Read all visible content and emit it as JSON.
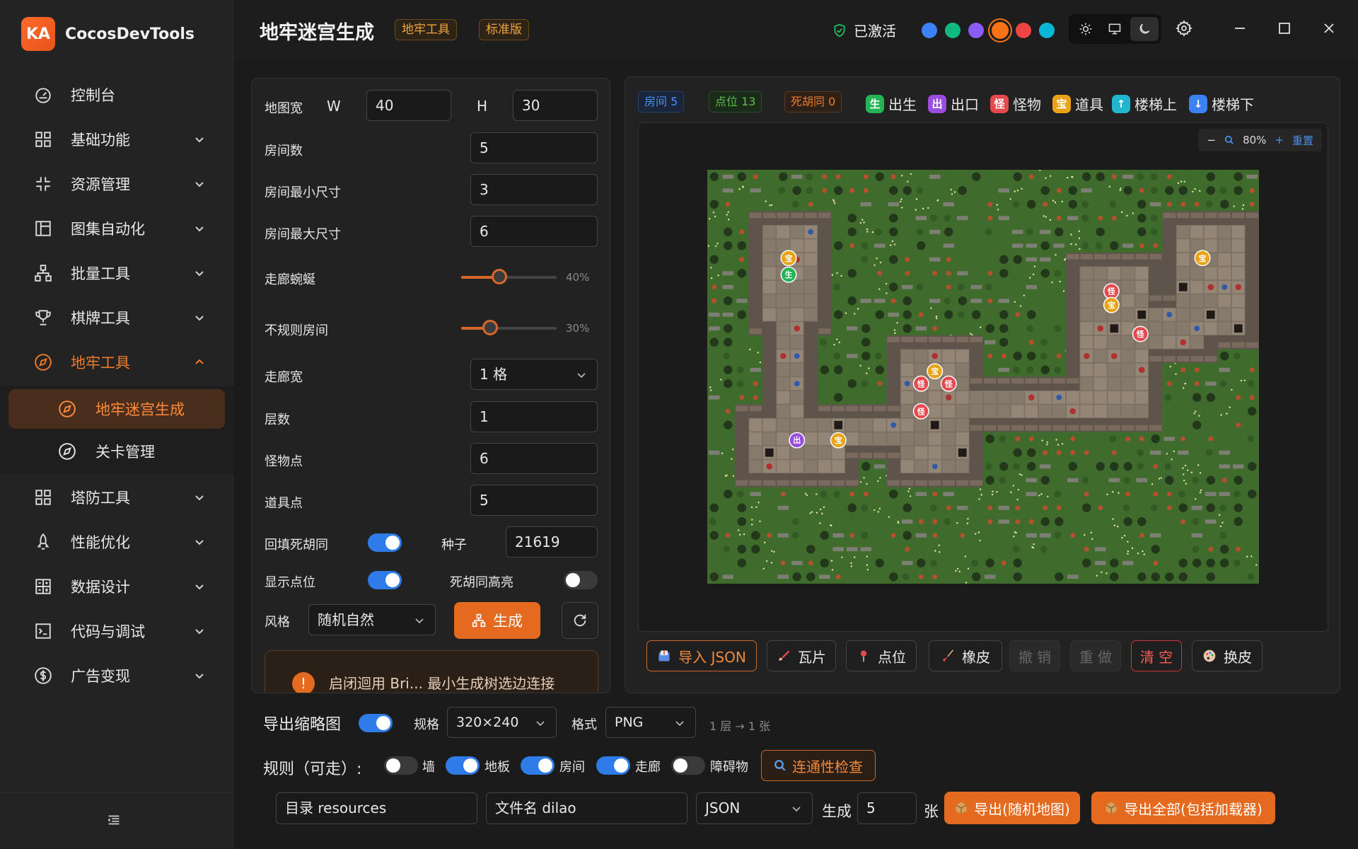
{
  "app": {
    "logo_text": "KA",
    "name": "CocosDevTools"
  },
  "sidebar": {
    "items": [
      {
        "label": "控制台",
        "icon": "dashboard-icon"
      },
      {
        "label": "基础功能",
        "icon": "grid-icon"
      },
      {
        "label": "资源管理",
        "icon": "compress-icon"
      },
      {
        "label": "图集自动化",
        "icon": "layout-icon"
      },
      {
        "label": "批量工具",
        "icon": "hierarchy-icon"
      },
      {
        "label": "棋牌工具",
        "icon": "trophy-icon"
      },
      {
        "label": "地牢工具",
        "icon": "compass-icon"
      },
      {
        "label": "塔防工具",
        "icon": "grid-icon"
      },
      {
        "label": "性能优化",
        "icon": "rocket-icon"
      },
      {
        "label": "数据设计",
        "icon": "calculator-icon"
      },
      {
        "label": "代码与调试",
        "icon": "terminal-icon"
      },
      {
        "label": "广告变现",
        "icon": "dollar-icon"
      }
    ],
    "sub_items": [
      {
        "label": "地牢迷宫生成",
        "icon": "compass-icon"
      },
      {
        "label": "关卡管理",
        "icon": "compass-icon"
      }
    ]
  },
  "header": {
    "title": "地牢迷宫生成",
    "tags": [
      "地牢工具",
      "标准版"
    ],
    "status": "已激活",
    "accent_colors": [
      "#3b82f6",
      "#10b981",
      "#8b5cf6",
      "#f97316",
      "#ef4444",
      "#06b6d4"
    ],
    "selected_accent": "#f97316"
  },
  "form": {
    "map_width_label": "地图宽",
    "w_label": "W",
    "w_value": "40",
    "h_label": "H",
    "h_value": "30",
    "rooms_label": "房间数",
    "rooms_value": "5",
    "room_min_label": "房间最小尺寸",
    "room_min_value": "3",
    "room_max_label": "房间最大尺寸",
    "room_max_value": "6",
    "winding_label": "走廊蜿蜒",
    "winding_pct": "40%",
    "winding_value": 0.4,
    "irregular_label": "不规则房间",
    "irregular_pct": "30%",
    "irregular_value": 0.3,
    "corridor_width_label": "走廊宽",
    "corridor_width_value": "1 格",
    "layers_label": "层数",
    "layers_value": "1",
    "monster_label": "怪物点",
    "monster_value": "6",
    "item_label": "道具点",
    "item_value": "5",
    "fill_deadend_label": "回填死胡同",
    "fill_deadend_on": true,
    "seed_label": "种子",
    "seed_value": "21619",
    "show_points_label": "显示点位",
    "show_points_on": true,
    "deadend_highlight_label": "死胡同高亮",
    "deadend_highlight_on": false,
    "style_label": "风格",
    "style_value": "随机自然",
    "generate_label": "生成",
    "tip_text": "启闭迴用 Bri... 最小生成树选边连接"
  },
  "map": {
    "chips": [
      {
        "label": "房间 5",
        "color": "#4b8ef0"
      },
      {
        "label": "点位 13",
        "color": "#5fbf4a"
      },
      {
        "label": "死胡同 0",
        "color": "#f07a2a"
      }
    ],
    "legend": [
      {
        "glyph": "生",
        "label": "出生",
        "color": "#22b455"
      },
      {
        "glyph": "出",
        "label": "出口",
        "color": "#9b4de0"
      },
      {
        "glyph": "怪",
        "label": "怪物",
        "color": "#e5484d"
      },
      {
        "glyph": "宝",
        "label": "道具",
        "color": "#e8a317"
      },
      {
        "glyph": "↑",
        "label": "楼梯上",
        "color": "#22b5d0"
      },
      {
        "glyph": "↓",
        "label": "楼梯下",
        "color": "#3b82f6"
      }
    ],
    "zoom": "80%",
    "reset_label": "重置",
    "markers": [
      {
        "glyph": "宝",
        "type": "item",
        "col": 5.9,
        "row": 6.4
      },
      {
        "glyph": "生",
        "type": "spawn",
        "col": 5.9,
        "row": 7.6
      },
      {
        "glyph": "宝",
        "type": "item",
        "col": 35.9,
        "row": 6.4
      },
      {
        "glyph": "怪",
        "type": "monster",
        "col": 29.3,
        "row": 8.8
      },
      {
        "glyph": "宝",
        "type": "item",
        "col": 29.3,
        "row": 9.8
      },
      {
        "glyph": "怪",
        "type": "monster",
        "col": 31.4,
        "row": 11.9
      },
      {
        "glyph": "宝",
        "type": "item",
        "col": 16.5,
        "row": 14.6
      },
      {
        "glyph": "怪",
        "type": "monster",
        "col": 15.5,
        "row": 15.5
      },
      {
        "glyph": "怪",
        "type": "monster",
        "col": 17.5,
        "row": 15.5
      },
      {
        "glyph": "怪",
        "type": "monster",
        "col": 15.5,
        "row": 17.5
      },
      {
        "glyph": "出",
        "type": "exit",
        "col": 6.5,
        "row": 19.6
      },
      {
        "glyph": "宝",
        "type": "item",
        "col": 9.5,
        "row": 19.6
      }
    ]
  },
  "toolbar": {
    "import_json": "导入 JSON",
    "tile": "瓦片",
    "point": "点位",
    "eraser": "橡皮",
    "undo": "撤 销",
    "redo": "重 做",
    "clear": "清 空",
    "skin": "换皮"
  },
  "export": {
    "thumb_label": "导出缩略图",
    "thumb_on": true,
    "size_label": "规格",
    "size_value": "320×240",
    "format_label": "格式",
    "format_value": "PNG",
    "note": "1 层 → 1 张"
  },
  "rules": {
    "label": "规则（可走）:",
    "items": [
      {
        "label": "墙",
        "on": false
      },
      {
        "label": "地板",
        "on": true
      },
      {
        "label": "房间",
        "on": true
      },
      {
        "label": "走廊",
        "on": true
      },
      {
        "label": "障碍物",
        "on": false
      }
    ],
    "check_label": "连通性检查"
  },
  "output": {
    "dir": "目录 resources",
    "filename": "文件名 dilao",
    "format": "JSON",
    "gen_label": "生成",
    "count": "5",
    "unit": "张",
    "export_random": "导出(随机地图)",
    "export_all": "导出全部(包括加载器)"
  }
}
